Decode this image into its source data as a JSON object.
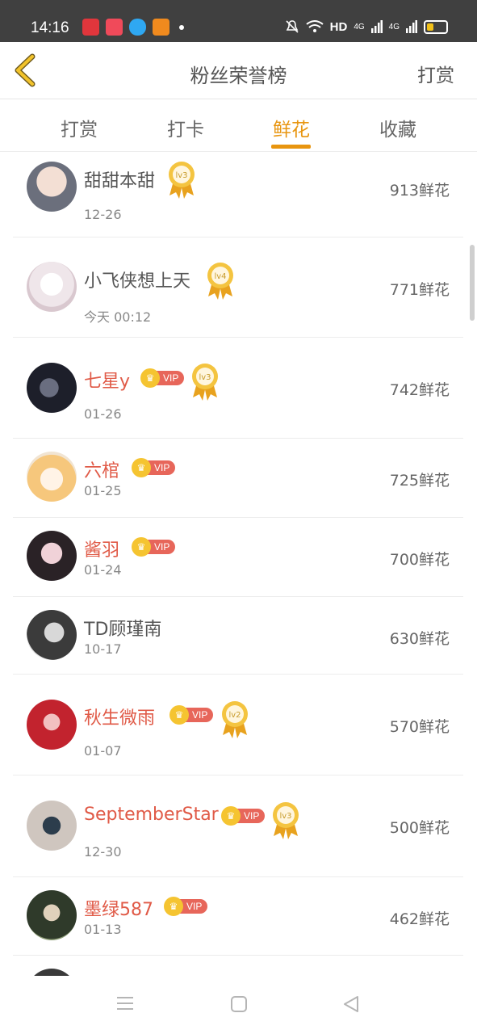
{
  "status_bar": {
    "time": "14:16",
    "network_label": "HD",
    "signal_label_1": "4G",
    "signal_label_2": "4G"
  },
  "header": {
    "title": "粉丝荣誉榜",
    "action": "打赏"
  },
  "tabs": [
    {
      "label": "打赏",
      "active": false
    },
    {
      "label": "打卡",
      "active": false
    },
    {
      "label": "鲜花",
      "active": true
    },
    {
      "label": "收藏",
      "active": false
    }
  ],
  "vip_label": "VIP",
  "entries": [
    {
      "name": "甜甜本甜",
      "date": "12-26",
      "count": "913鲜花",
      "vip": false,
      "level": "lv3"
    },
    {
      "name": "小飞侠想上天",
      "date": "今天 00:12",
      "count": "771鲜花",
      "vip": false,
      "level": "lv4"
    },
    {
      "name": "七星y",
      "date": "01-26",
      "count": "742鲜花",
      "vip": true,
      "level": "lv3"
    },
    {
      "name": "六棺",
      "date": "01-25",
      "count": "725鲜花",
      "vip": true,
      "level": ""
    },
    {
      "name": "酱羽",
      "date": "01-24",
      "count": "700鲜花",
      "vip": true,
      "level": ""
    },
    {
      "name": "TD顾瑾南",
      "date": "10-17",
      "count": "630鲜花",
      "vip": false,
      "level": ""
    },
    {
      "name": "秋生微雨",
      "date": "01-07",
      "count": "570鲜花",
      "vip": true,
      "level": "lv2"
    },
    {
      "name": "SeptemberStar",
      "date": "12-30",
      "count": "500鲜花",
      "vip": true,
      "level": "lv3"
    },
    {
      "name": "墨绿587",
      "date": "01-13",
      "count": "462鲜花",
      "vip": true,
      "level": ""
    }
  ],
  "colors": {
    "accent": "#e8950f",
    "vip_name": "#e05a47",
    "status_bar": "#404040"
  }
}
